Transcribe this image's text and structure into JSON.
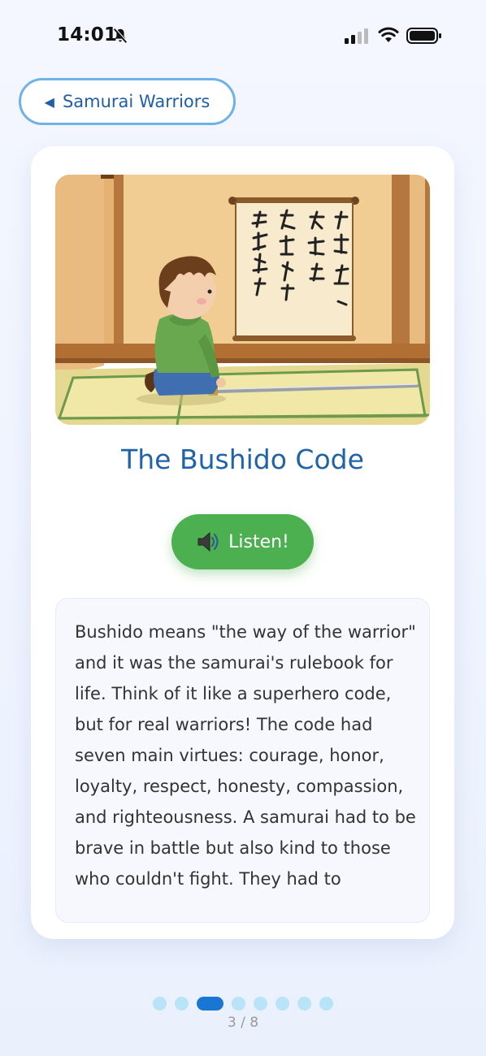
{
  "status_bar": {
    "time": "14:01",
    "icons": [
      "bell-slash-icon",
      "cellular-signal-icon",
      "wifi-icon",
      "battery-icon"
    ]
  },
  "nav": {
    "back_label": "Samurai Warriors",
    "back_icon": "triangle-left-icon"
  },
  "card": {
    "illustration_icon": "boy-kneeling-with-sword-before-scroll-illustration",
    "title": "The Bushido Code",
    "listen_label": "Listen!",
    "listen_icon": "speaker-icon",
    "body": "Bushido means \"the way of the warrior\" and it was the samurai's rulebook for life. Think of it like a superhero code, but for real warriors! The code had seven main virtues: courage, honor, loyalty, respect, honesty, compassion, and righteousness. A samurai had to be brave in battle but also kind to those who couldn't fight. They had to"
  },
  "pager": {
    "total": 8,
    "current": 3,
    "label": "3 / 8"
  },
  "colors": {
    "accent_blue": "#1f64a8",
    "listen_green": "#4caf50",
    "dot_inactive": "#b9e3f7",
    "dot_active": "#1976d2",
    "back_border": "#6fb2e8"
  }
}
